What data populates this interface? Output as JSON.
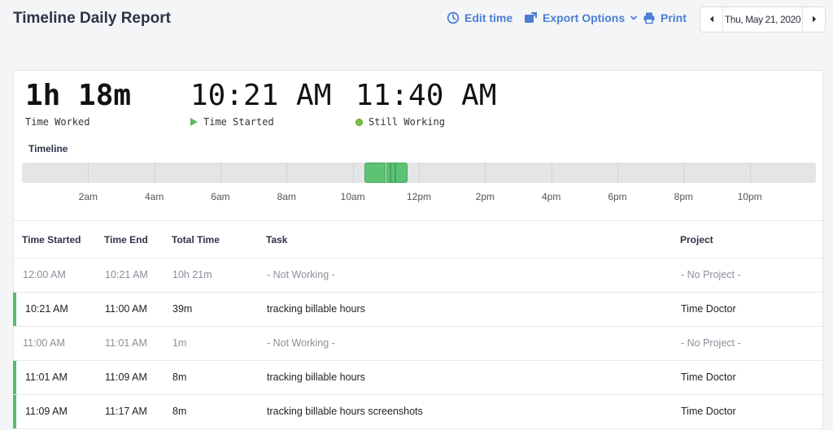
{
  "header": {
    "title": "Timeline Daily Report",
    "edit_time": "Edit time",
    "export_options": "Export Options",
    "print": "Print",
    "date": "Thu, May 21, 2020"
  },
  "summary": {
    "time_worked": {
      "value": "1h 18m",
      "label": "Time Worked"
    },
    "time_started": {
      "value": "10:21 AM",
      "label": "Time Started"
    },
    "still_working": {
      "value": "11:40 AM",
      "label": "Still Working"
    }
  },
  "timeline": {
    "title": "Timeline",
    "tick_labels": [
      "2am",
      "4am",
      "6am",
      "8am",
      "10am",
      "12pm",
      "2pm",
      "4pm",
      "6pm",
      "8pm",
      "10pm"
    ],
    "tracked_hours": [
      [
        10.35,
        11.0
      ],
      [
        11.017,
        11.15
      ],
      [
        11.15,
        11.283
      ],
      [
        11.283,
        11.667
      ]
    ]
  },
  "table": {
    "columns": [
      "Time Started",
      "Time End",
      "Total Time",
      "Task",
      "Project"
    ],
    "rows": [
      {
        "start": "12:00 AM",
        "end": "10:21 AM",
        "total": "10h 21m",
        "task": "- Not Working -",
        "project": "- No Project -",
        "working": false
      },
      {
        "start": "10:21 AM",
        "end": "11:00 AM",
        "total": "39m",
        "task": "tracking billable hours",
        "project": "Time Doctor",
        "working": true
      },
      {
        "start": "11:00 AM",
        "end": "11:01 AM",
        "total": "1m",
        "task": "- Not Working -",
        "project": "- No Project -",
        "working": false
      },
      {
        "start": "11:01 AM",
        "end": "11:09 AM",
        "total": "8m",
        "task": "tracking billable hours",
        "project": "Time Doctor",
        "working": true
      },
      {
        "start": "11:09 AM",
        "end": "11:17 AM",
        "total": "8m",
        "task": "tracking billable hours screenshots",
        "project": "Time Doctor",
        "working": true
      }
    ]
  },
  "colors": {
    "accent": "#4a7fd6",
    "working": "#5ec275",
    "track": "#e4e5e7"
  }
}
